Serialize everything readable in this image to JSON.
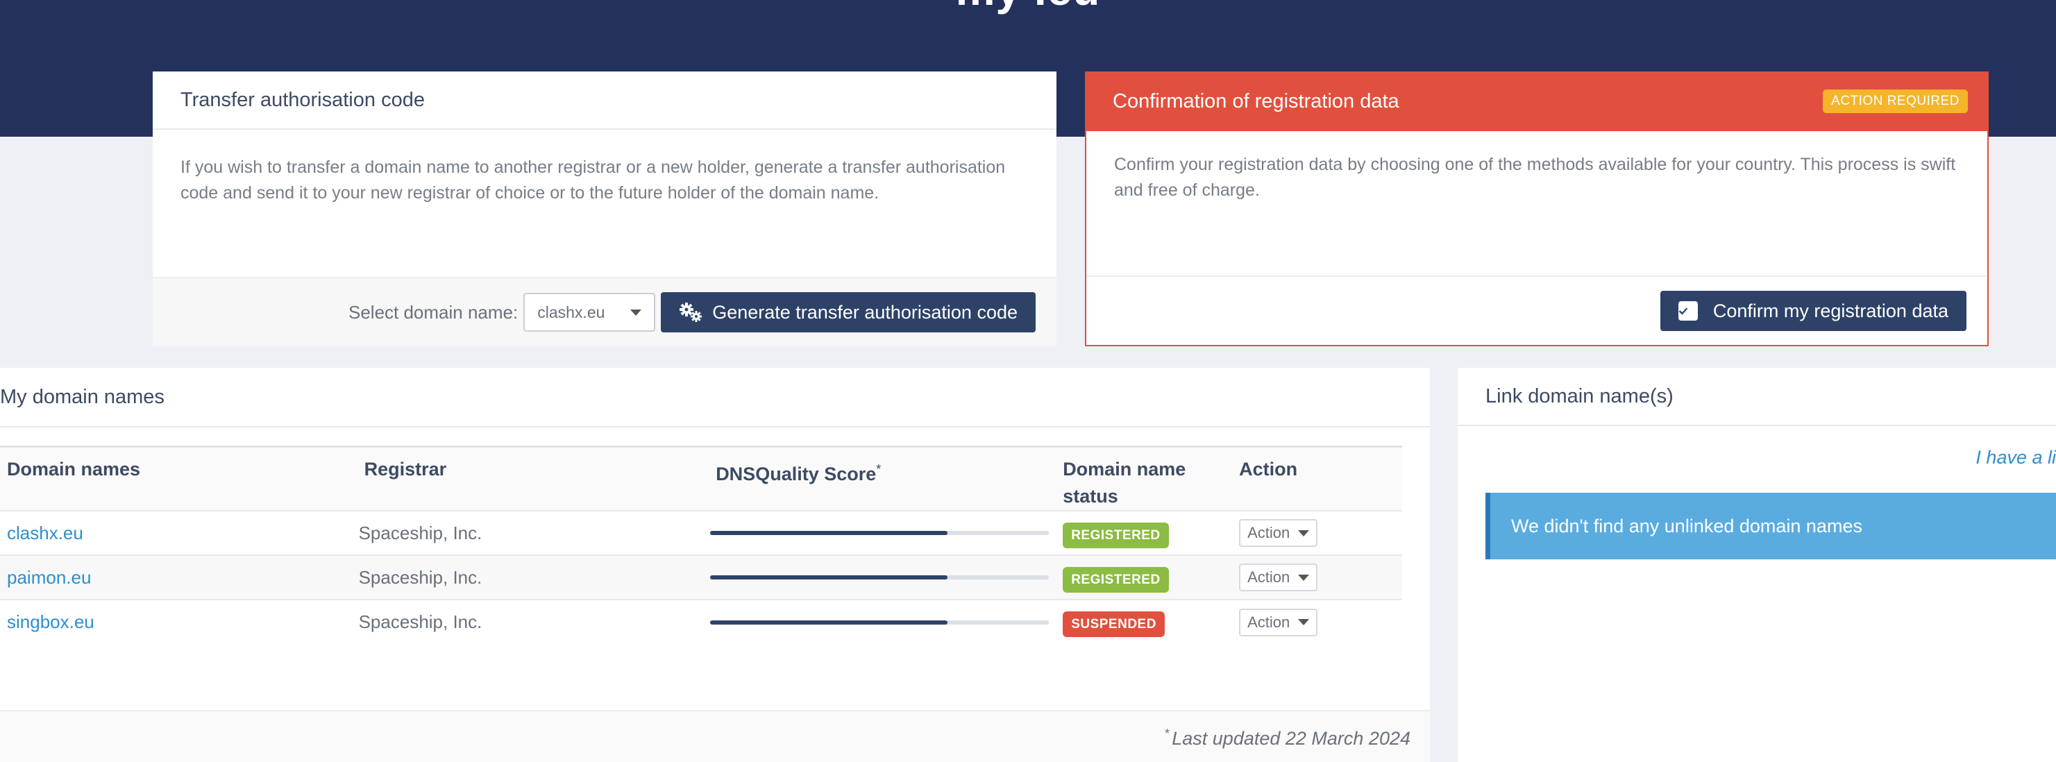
{
  "hero": {
    "title": "my .eu"
  },
  "transfer": {
    "title": "Transfer authorisation code",
    "body": "If you wish to transfer a domain name to another registrar or a new holder, generate a transfer authorisation code and send it to your new registrar of choice or to the future holder of the domain name.",
    "select_label": "Select domain name:",
    "selected_domain": "clashx.eu",
    "button_label": "Generate transfer authorisation code",
    "button_icon": "gears-icon"
  },
  "confirmation": {
    "title": "Confirmation of registration data",
    "badge": "ACTION REQUIRED",
    "body": "Confirm your registration data by choosing one of the methods available for your country. This process is swift and free of charge.",
    "button_label": "Confirm my registration data",
    "button_icon": "checkbox-icon"
  },
  "domains": {
    "title": "My domain names",
    "columns": [
      "Domain names",
      "Registrar",
      "DNSQuality Score",
      "Domain name status",
      "Action"
    ],
    "score_footnote_mark": "*",
    "rows": [
      {
        "name": "clashx.eu",
        "registrar": "Spaceship, Inc.",
        "score": 0.7,
        "status": "REGISTERED",
        "status_type": "ok",
        "action": "Action"
      },
      {
        "name": "paimon.eu",
        "registrar": "Spaceship, Inc.",
        "score": 0.7,
        "status": "REGISTERED",
        "status_type": "ok",
        "action": "Action"
      },
      {
        "name": "singbox.eu",
        "registrar": "Spaceship, Inc.",
        "score": 0.7,
        "status": "SUSPENDED",
        "status_type": "bad",
        "action": "Action"
      }
    ],
    "footnote_mark": "*",
    "footnote": "Last updated 22 March 2024"
  },
  "link": {
    "title": "Link domain name(s)",
    "hint": "I have a li",
    "info": "We didn't find any unlinked domain names"
  },
  "colors": {
    "navy": "#24315c",
    "button": "#2e4268",
    "danger": "#e1503e",
    "warning": "#f4b52b",
    "success": "#8cbc44",
    "link": "#2c8fd0",
    "info": "#5aacdf"
  }
}
